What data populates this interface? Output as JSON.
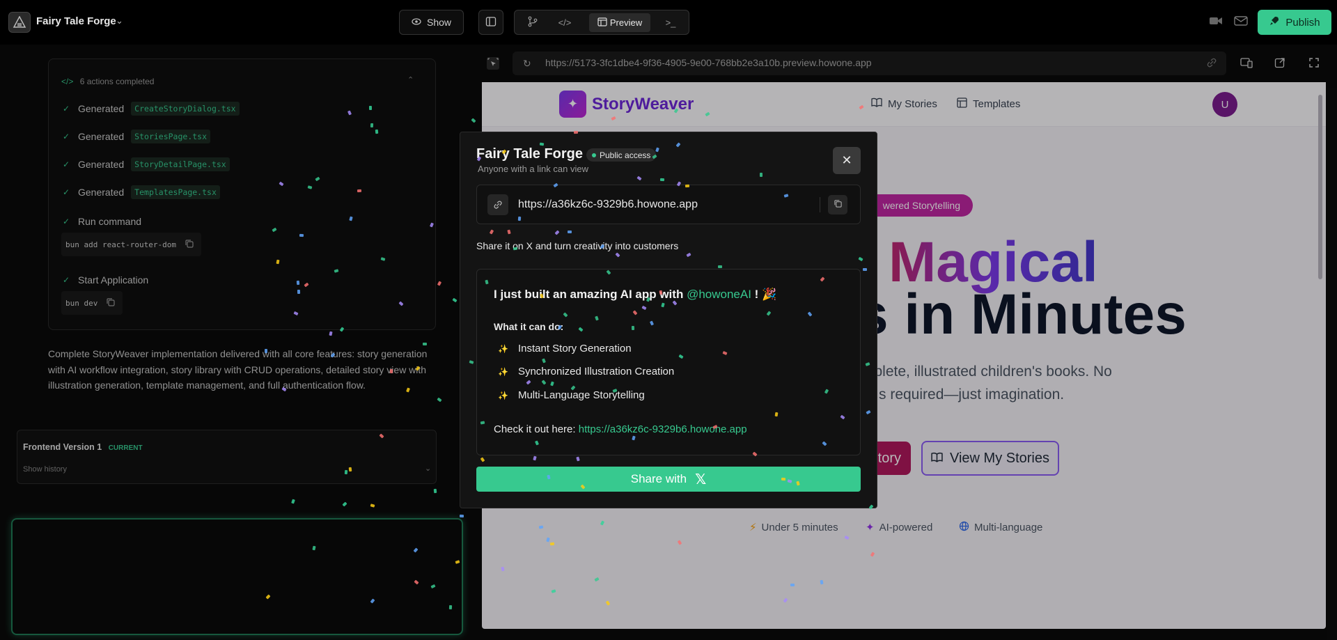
{
  "project": {
    "name": "Fairy Tale Forge"
  },
  "toolbar": {
    "show_label": "Show",
    "preview_label": "Preview",
    "publish_label": "Publish"
  },
  "actions": {
    "header": "6 actions completed",
    "generated_label": "Generated",
    "files": [
      "CreateStoryDialog.tsx",
      "StoriesPage.tsx",
      "StoryDetailPage.tsx",
      "TemplatesPage.tsx"
    ],
    "run_command_label": "Run command",
    "run_command_value": "bun add react-router-dom",
    "start_app_label": "Start Application",
    "start_app_value": "bun dev"
  },
  "summary": "Complete StoryWeaver implementation delivered with all core features: story generation with AI workflow integration, story library with CRUD operations, detailed story view with illustration generation, template management, and full authentication flow.",
  "version": {
    "label": "Frontend Version 1",
    "badge": "CURRENT",
    "history_label": "Show history"
  },
  "preview": {
    "url": "https://5173-3fc1dbe4-9f36-4905-9e00-768bb2e3a10b.preview.howone.app",
    "site": {
      "brand": "StoryWeaver",
      "nav": [
        "My Stories",
        "Templates"
      ],
      "avatar": "U",
      "badge": "wered Storytelling",
      "headline_1": "Magical",
      "headline_2": "s in Minutes",
      "sub_1": "mplete, illustrated children's books. No",
      "sub_2": "s required—just imagination.",
      "cta_primary": "tory",
      "cta_secondary": "View My Stories",
      "features": [
        "Under 5 minutes",
        "AI-powered",
        "Multi-language"
      ]
    }
  },
  "modal": {
    "title": "Fairy Tale Forge",
    "access_badge": "Public access",
    "subtitle": "Anyone with a link can view",
    "link": "https://a36kz6c-9329b6.howone.app",
    "share_prompt": "Share it on X and turn creativity into customers",
    "tweet": {
      "line1_pre": "I just built an amazing AI app with",
      "mention": "@howoneAI",
      "line1_post": "! 🎉",
      "can_do": "What it can do:",
      "items": [
        "Instant Story Generation",
        "Synchronized Illustration Creation",
        "Multi-Language Storytelling"
      ],
      "check_pre": "Check it out here:",
      "check_link": "https://a36kz6c-9329b6.howone.app"
    },
    "share_button": "Share with",
    "share_button_logo": "𝕏"
  },
  "colors": {
    "accent": "#37c98f",
    "brand_purple": "#6d28d9",
    "magenta": "#c026a3"
  }
}
